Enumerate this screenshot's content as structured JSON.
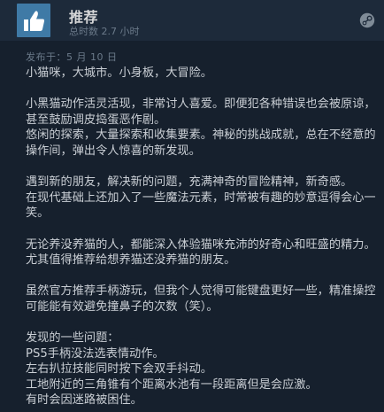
{
  "review": {
    "verdict": "推荐",
    "hours": "总时数 2.7 小时",
    "posted": "发布于：5 月 10 日",
    "paragraphs": [
      [
        "小猫咪，大城市。小身板，大冒险。"
      ],
      [
        "小黑猫动作活灵活现，非常讨人喜爱。即便犯各种错误也会被原谅，",
        "甚至鼓励调皮捣蛋恶作剧。",
        "悠闲的探索，大量探索和收集要素。神秘的挑战成就，总在不经意的",
        "操作间，弹出令人惊喜的新发现。"
      ],
      [
        "遇到新的朋友，解决新的问题，充满神奇的冒险精神，新奇感。",
        "在现代基础上还加入了一些魔法元素，时常被有趣的妙意逗得会心一",
        "笑。"
      ],
      [
        "无论养没养猫的人，都能深入体验猫咪充沛的好奇心和旺盛的精力。",
        "尤其值得推荐给想养猫还没养猫的朋友。"
      ],
      [
        "虽然官方推荐手柄游玩，但我个人觉得可能键盘更好一些，精准操控",
        "可能能有效避免撞鼻子的次数（笑）。"
      ],
      [
        "发现的一些问题：",
        "PS5手柄没法选表情动作。",
        "左右扒拉技能同时按下会双手抖动。",
        "工地附近的三角锥有个距离水池有一段距离但是会应激。",
        "有时会因迷路被困住。"
      ]
    ]
  },
  "icons": {
    "thumb": "thumbs-up-icon",
    "steam": "steam-logo-icon"
  },
  "colors": {
    "background": "#16202d",
    "header": "#1d2a3a",
    "thumb_box": "#3f7aa6"
  }
}
